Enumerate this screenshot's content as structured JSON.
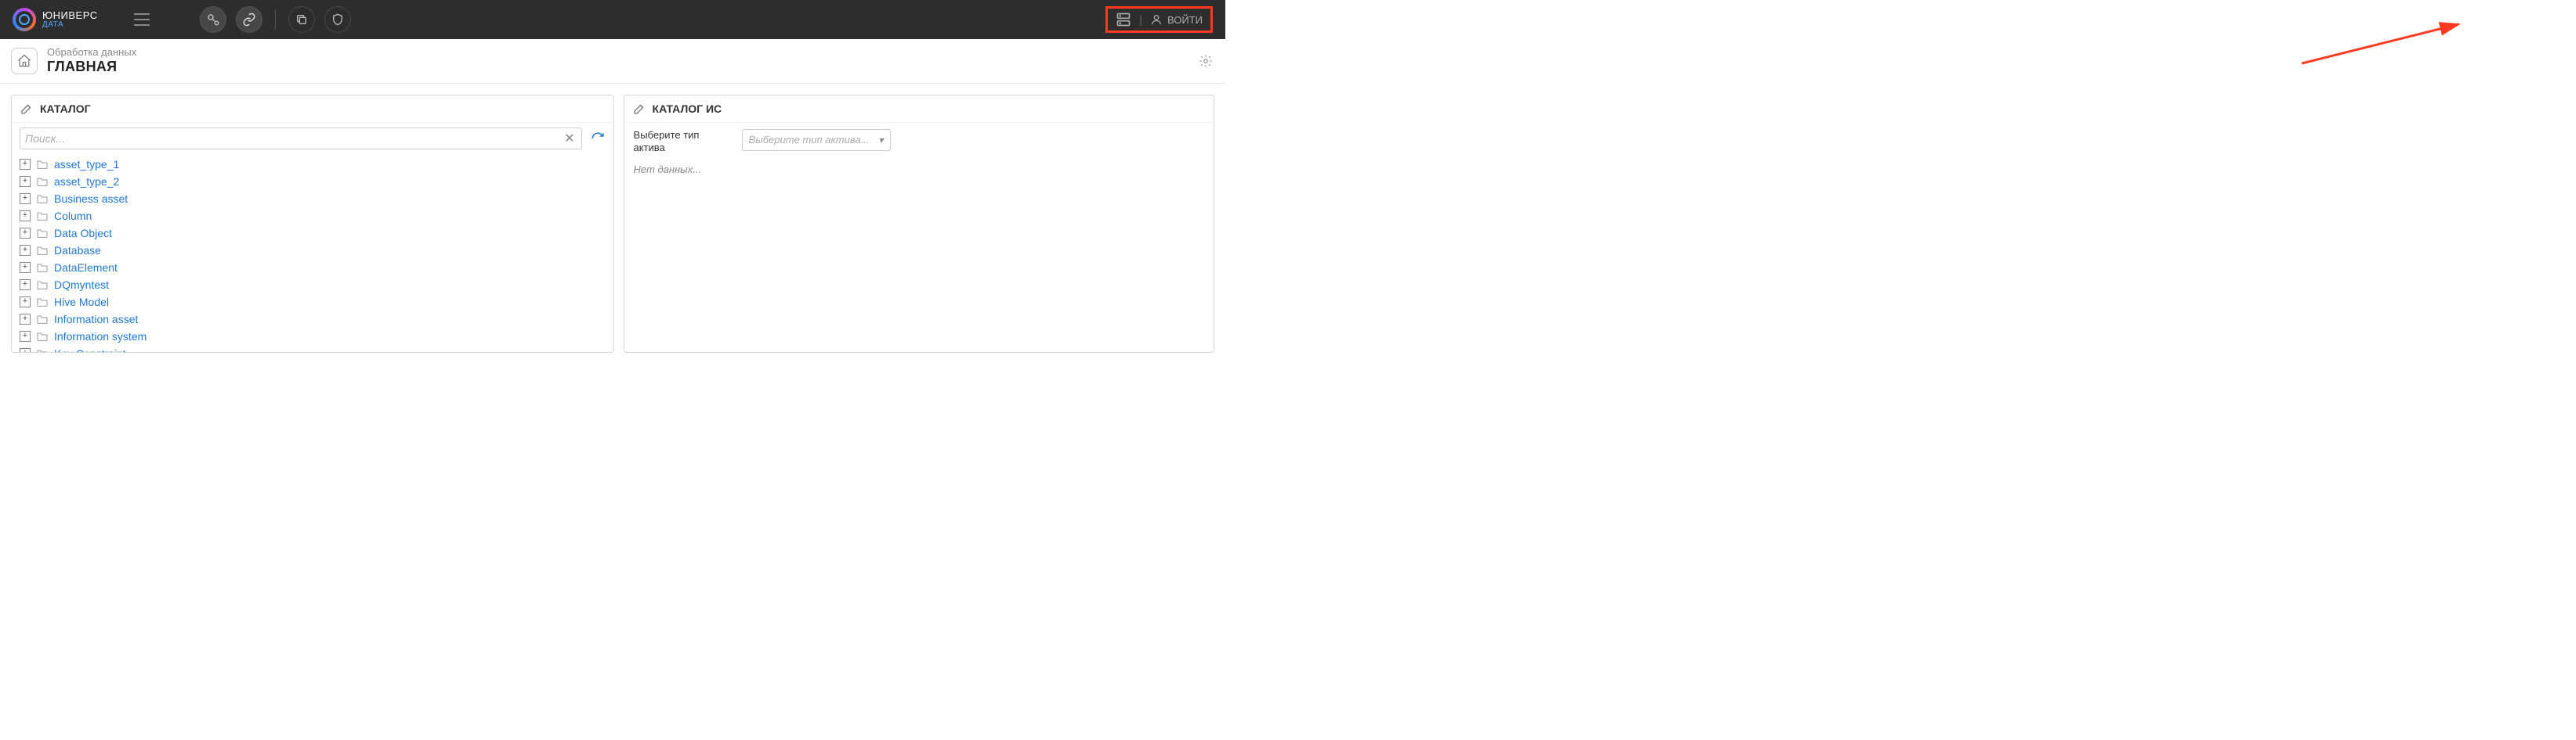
{
  "brand": {
    "title": "ЮНИВЕРС",
    "subtitle": "ДАТА"
  },
  "login_label": "ВОЙТИ",
  "breadcrumb": {
    "section": "Обработка данных",
    "page": "ГЛАВНАЯ"
  },
  "left_panel": {
    "title": "КАТАЛОГ",
    "search_placeholder": "Поиск...",
    "items": [
      "asset_type_1",
      "asset_type_2",
      "Business asset",
      "Column",
      "Data Object",
      "Database",
      "DataElement",
      "DQmyntest",
      "Hive Model",
      "Information asset",
      "Information system",
      "Key Constraint"
    ]
  },
  "right_panel": {
    "title": "КАТАЛОГ ИС",
    "select_label": "Выберите тип актива",
    "select_placeholder": "Выберите тип актива...",
    "no_data": "Нет данных..."
  }
}
